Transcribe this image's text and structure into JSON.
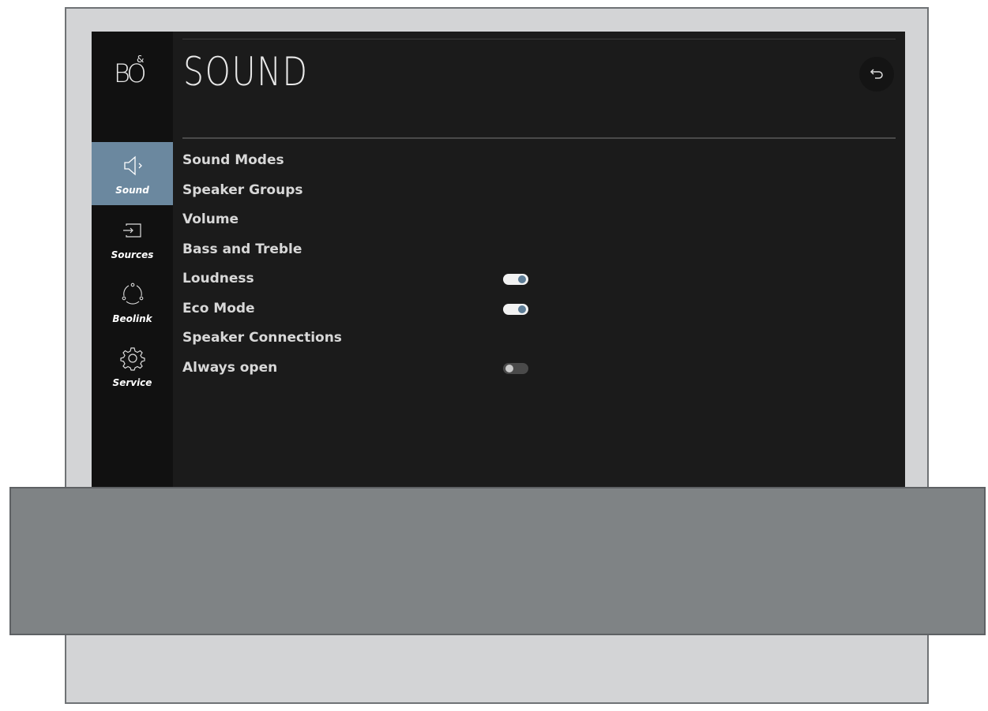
{
  "screen": {
    "logo": {
      "letters": "BO",
      "ampersand": "&"
    },
    "title": "SOUND",
    "back_icon": "back-arrow-icon"
  },
  "sidebar": {
    "items": [
      {
        "label": "Sound",
        "icon": "speaker-icon",
        "active": true
      },
      {
        "label": "Sources",
        "icon": "input-source-icon",
        "active": false
      },
      {
        "label": "Beolink",
        "icon": "beolink-icon",
        "active": false
      },
      {
        "label": "Service",
        "icon": "gear-icon",
        "active": false
      }
    ]
  },
  "menu": {
    "items": [
      {
        "label": "Sound Modes"
      },
      {
        "label": "Speaker Groups"
      },
      {
        "label": "Volume"
      },
      {
        "label": "Bass and Treble"
      },
      {
        "label": "Loudness",
        "toggle": "on"
      },
      {
        "label": "Eco Mode",
        "toggle": "on"
      },
      {
        "label": "Speaker Connections"
      },
      {
        "label": "Always open",
        "toggle": "off"
      }
    ]
  },
  "colors": {
    "accent": "#6b889f",
    "background": "#1b1b1b",
    "sidebar": "#111111",
    "frame": "#d3d4d6",
    "overlay": "#7f8385"
  }
}
